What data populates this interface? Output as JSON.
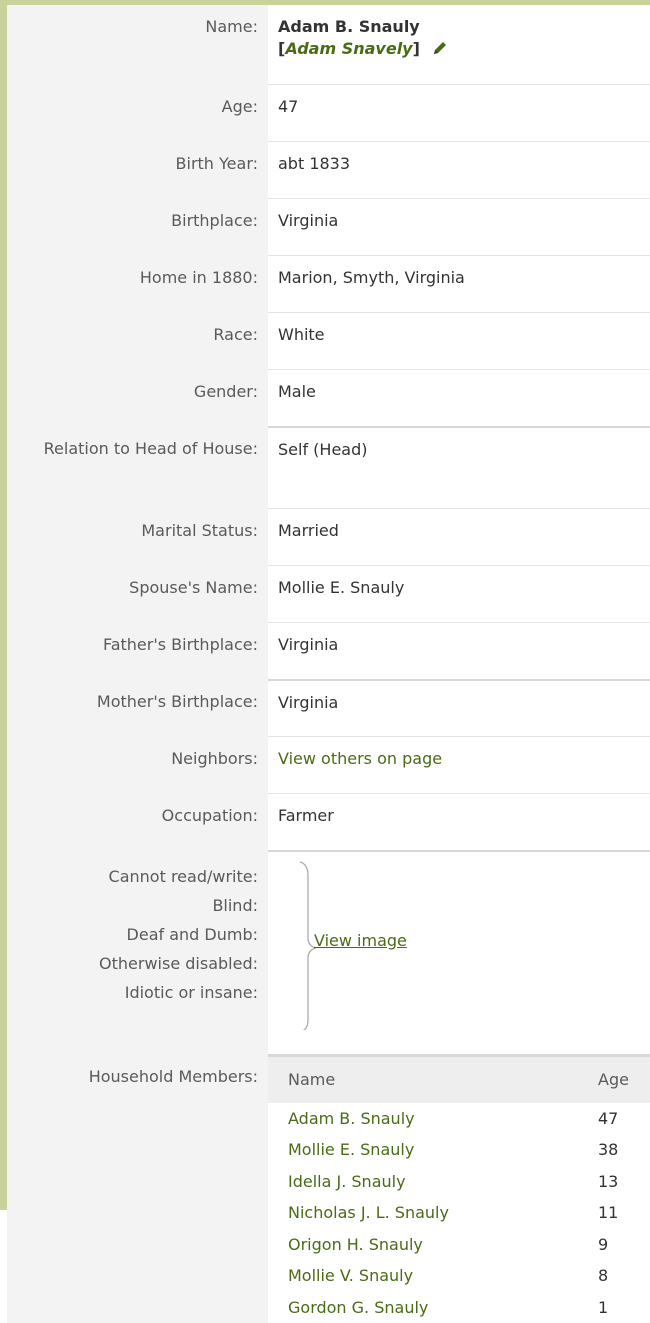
{
  "record": {
    "name_label": "Name:",
    "name": "Adam B. Snauly",
    "alt_name_open": "[",
    "alt_name": "Adam Snavely",
    "alt_name_close": "]",
    "edit_icon": "pencil-icon",
    "rows": [
      {
        "label": "Age:",
        "value": "47"
      },
      {
        "label": "Birth Year:",
        "value": "abt 1833"
      },
      {
        "label": "Birthplace:",
        "value": "Virginia"
      },
      {
        "label": "Home in 1880:",
        "value": "Marion, Smyth, Virginia"
      },
      {
        "label": "Race:",
        "value": "White"
      },
      {
        "label": "Gender:",
        "value": "Male"
      },
      {
        "label": "Relation to Head of House:",
        "value": "Self (Head)"
      },
      {
        "label": "Marital Status:",
        "value": "Married"
      },
      {
        "label": "Spouse's Name:",
        "value": "Mollie E. Snauly"
      },
      {
        "label": "Father's Birthplace:",
        "value": "Virginia"
      },
      {
        "label": "Mother's Birthplace:",
        "value": "Virginia"
      }
    ],
    "neighbors_label": "Neighbors:",
    "neighbors_link": "View others on page",
    "occupation_label": "Occupation:",
    "occupation": "Farmer",
    "disability_labels": [
      "Cannot read/write:",
      "Blind:",
      "Deaf and Dumb:",
      "Otherwise disabled:",
      "Idiotic or insane:"
    ],
    "view_image_link": "View image",
    "household_label": "Household Members:",
    "household_columns": {
      "name": "Name",
      "age": "Age"
    },
    "household": [
      {
        "name": "Adam B. Snauly",
        "age": "47"
      },
      {
        "name": "Mollie E. Snauly",
        "age": "38"
      },
      {
        "name": "Idella J. Snauly",
        "age": "13"
      },
      {
        "name": "Nicholas J. L. Snauly",
        "age": "11"
      },
      {
        "name": "Origon H. Snauly",
        "age": "9"
      },
      {
        "name": "Mollie V. Snauly",
        "age": "8"
      },
      {
        "name": "Gordon G. Snauly",
        "age": "1"
      }
    ],
    "colors": {
      "link": "#4a6b16",
      "frame": "#c9d29a",
      "label_bg": "#f3f3f3"
    }
  }
}
